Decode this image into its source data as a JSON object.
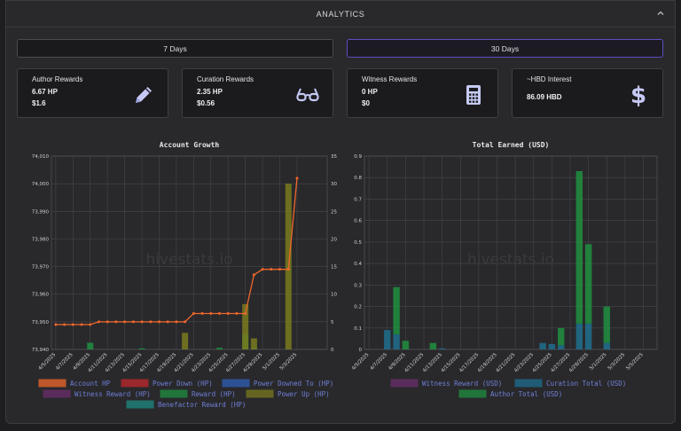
{
  "header": {
    "title": "ANALYTICS"
  },
  "range": {
    "seven": "7 Days",
    "thirty": "30 Days",
    "active": "30 Days"
  },
  "cards": [
    {
      "title": "Author Rewards",
      "v1": "6.67 HP",
      "v2": "$1.6",
      "icon": "pencil-icon"
    },
    {
      "title": "Curation Rewards",
      "v1": "2.35 HP",
      "v2": "$0.56",
      "icon": "glasses-icon"
    },
    {
      "title": "Witness Rewards",
      "v1": "0 HP",
      "v2": "$0",
      "icon": "calculator-icon"
    },
    {
      "title": "~HBD Interest",
      "v1": "86.09 HBD",
      "v2": "",
      "icon": "dollar-icon"
    }
  ],
  "colors": {
    "accent": "#5b4fc0",
    "icon": "#c5c9f3"
  },
  "chart_data": [
    {
      "type": "bar",
      "title": "Account Growth",
      "watermark": "hivestats.io",
      "x": [
        "4/5/2025",
        "4/6/2025",
        "4/7/2025",
        "4/8/2025",
        "4/9/2025",
        "4/10/2025",
        "4/11/2025",
        "4/12/2025",
        "4/13/2025",
        "4/14/2025",
        "4/15/2025",
        "4/16/2025",
        "4/17/2025",
        "4/18/2025",
        "4/19/2025",
        "4/20/2025",
        "4/21/2025",
        "4/22/2025",
        "4/23/2025",
        "4/24/2025",
        "4/25/2025",
        "4/26/2025",
        "4/27/2025",
        "4/28/2025",
        "4/29/2025",
        "4/30/2025",
        "5/1/2025",
        "5/2/2025",
        "5/3/2025",
        "5/4/2025",
        "5/5/2025",
        "5/6/2025"
      ],
      "xtick_labels": [
        "4/5/2025",
        "4/7/2025",
        "4/9/2025",
        "4/11/2025",
        "4/13/2025",
        "4/15/2025",
        "4/17/2025",
        "4/19/2025",
        "4/21/2025",
        "4/23/2025",
        "4/25/2025",
        "4/27/2025",
        "4/29/2025",
        "5/1/2025",
        "5/3/2025"
      ],
      "ylim_left": [
        73940,
        74010
      ],
      "yticks_left": [
        "73,940",
        "73,950",
        "73,960",
        "73,970",
        "73,980",
        "73,990",
        "74,000",
        "74,010"
      ],
      "ylim_right": [
        0,
        35
      ],
      "yticks_right": [
        "0",
        "5",
        "10",
        "15",
        "20",
        "25",
        "30",
        "35"
      ],
      "grid": true,
      "legend_placement": "bottom",
      "series": [
        {
          "name": "Account HP",
          "kind": "line",
          "axis": "left",
          "color": "#f0672a",
          "values": [
            73949,
            73949,
            73949,
            73949,
            73949,
            73950,
            73950,
            73950,
            73950,
            73950,
            73950,
            73950,
            73950,
            73950,
            73950,
            73950,
            73953,
            73953,
            73953,
            73953,
            73953,
            73953,
            73953,
            73967,
            73969,
            73969,
            73969,
            73969,
            74002
          ]
        },
        {
          "name": "Power Down (HP)",
          "kind": "bar",
          "axis": "right",
          "color": "#c0282d",
          "values": []
        },
        {
          "name": "Power Downed To (HP)",
          "kind": "bar",
          "axis": "right",
          "color": "#2f5fb8",
          "values": []
        },
        {
          "name": "Witness Reward (HP)",
          "kind": "bar",
          "axis": "right",
          "color": "#6b2e6b",
          "values": []
        },
        {
          "name": "Reward (HP)",
          "kind": "bar",
          "axis": "right",
          "color": "#1f8f3f",
          "values": [
            0,
            0,
            0,
            0,
            1.2,
            0,
            0,
            0,
            0,
            0,
            0.2,
            0,
            0,
            0,
            0,
            0,
            0,
            0,
            0,
            0.3,
            0,
            0,
            2.8,
            0.3,
            0,
            0,
            0,
            0,
            0,
            0,
            0,
            0
          ]
        },
        {
          "name": "Power Up (HP)",
          "kind": "bar",
          "axis": "right",
          "color": "#7a7a1e",
          "values": [
            0,
            0,
            0,
            0,
            0,
            0,
            0,
            0,
            0,
            0,
            0,
            0,
            0,
            0,
            0,
            3,
            0,
            0,
            0,
            0,
            0,
            0,
            8.2,
            2,
            0,
            0,
            0,
            30,
            0,
            0,
            0,
            0
          ]
        },
        {
          "name": "Benefactor Reward (HP)",
          "kind": "bar",
          "axis": "right",
          "color": "#1e8b83",
          "values": []
        }
      ]
    },
    {
      "type": "bar",
      "title": "Total Earned (USD)",
      "watermark": "hivestats.io",
      "x": [
        "4/5/2025",
        "4/6/2025",
        "4/7/2025",
        "4/8/2025",
        "4/9/2025",
        "4/10/2025",
        "4/11/2025",
        "4/12/2025",
        "4/13/2025",
        "4/14/2025",
        "4/15/2025",
        "4/16/2025",
        "4/17/2025",
        "4/18/2025",
        "4/19/2025",
        "4/20/2025",
        "4/21/2025",
        "4/22/2025",
        "4/23/2025",
        "4/24/2025",
        "4/25/2025",
        "4/26/2025",
        "4/27/2025",
        "4/28/2025",
        "4/29/2025",
        "4/30/2025",
        "5/1/2025",
        "5/2/2025",
        "5/3/2025",
        "5/4/2025",
        "5/5/2025",
        "5/6/2025"
      ],
      "xtick_labels": [
        "4/5/2025",
        "4/7/2025",
        "4/9/2025",
        "4/11/2025",
        "4/13/2025",
        "4/15/2025",
        "4/17/2025",
        "4/19/2025",
        "4/21/2025",
        "4/23/2025",
        "4/25/2025",
        "4/27/2025",
        "4/29/2025",
        "5/1/2025",
        "5/3/2025",
        "5/5/2025"
      ],
      "ylim": [
        0,
        0.9
      ],
      "yticks": [
        "0",
        "0.1",
        "0.2",
        "0.3",
        "0.4",
        "0.5",
        "0.6",
        "0.7",
        "0.8",
        "0.9"
      ],
      "grid": true,
      "stacked": true,
      "legend_placement": "bottom",
      "series": [
        {
          "name": "Witness Reward (USD)",
          "color": "#6b2e6b",
          "values": []
        },
        {
          "name": "Curation Total (USD)",
          "color": "#1e6e8e",
          "values": [
            0,
            0,
            0.09,
            0.07,
            0,
            0,
            0,
            0,
            0.005,
            0,
            0,
            0,
            0,
            0,
            0,
            0,
            0,
            0,
            0,
            0.03,
            0.025,
            0.02,
            0,
            0.12,
            0.12,
            0,
            0.03,
            0,
            0,
            0,
            0,
            0
          ]
        },
        {
          "name": "Author Total (USD)",
          "color": "#1f8f3f",
          "values": [
            0,
            0,
            0,
            0.22,
            0.04,
            0,
            0,
            0.03,
            0,
            0,
            0,
            0,
            0,
            0,
            0,
            0,
            0,
            0,
            0,
            0,
            0,
            0.08,
            0,
            0.71,
            0.37,
            0,
            0.17,
            0,
            0,
            0,
            0,
            0
          ]
        }
      ]
    }
  ]
}
